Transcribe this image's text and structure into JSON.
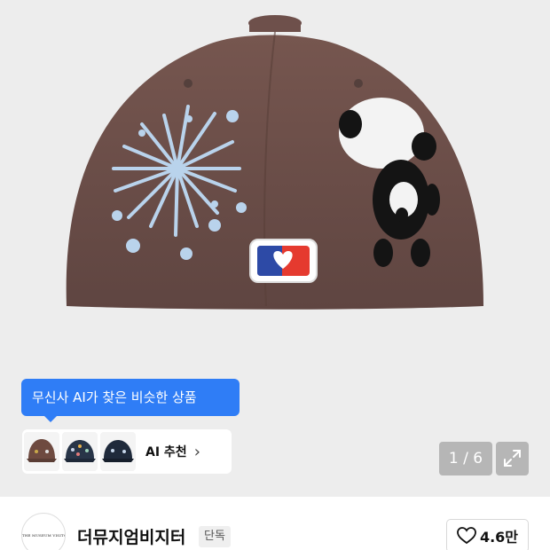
{
  "recommendation": {
    "tooltip": "무신사 AI가 찾은 비슷한 상품",
    "label": "AI 추천",
    "chevron": "›",
    "thumbnails": [
      "brown-cap",
      "navy-cap-patches",
      "navy-cap"
    ]
  },
  "gallery": {
    "pager": "1 / 6",
    "expand_icon": "expand-icon"
  },
  "brand": {
    "logo_text": "THE MUSEUM VISITOR",
    "name": "더뮤지엄비지터",
    "badge": "단독"
  },
  "like": {
    "icon": "heart-outline-icon",
    "count": "4.6만"
  },
  "colors": {
    "accent_blue": "#2f7df6",
    "cap_brown": "#6b4d49",
    "hero_bg": "#ededed"
  }
}
